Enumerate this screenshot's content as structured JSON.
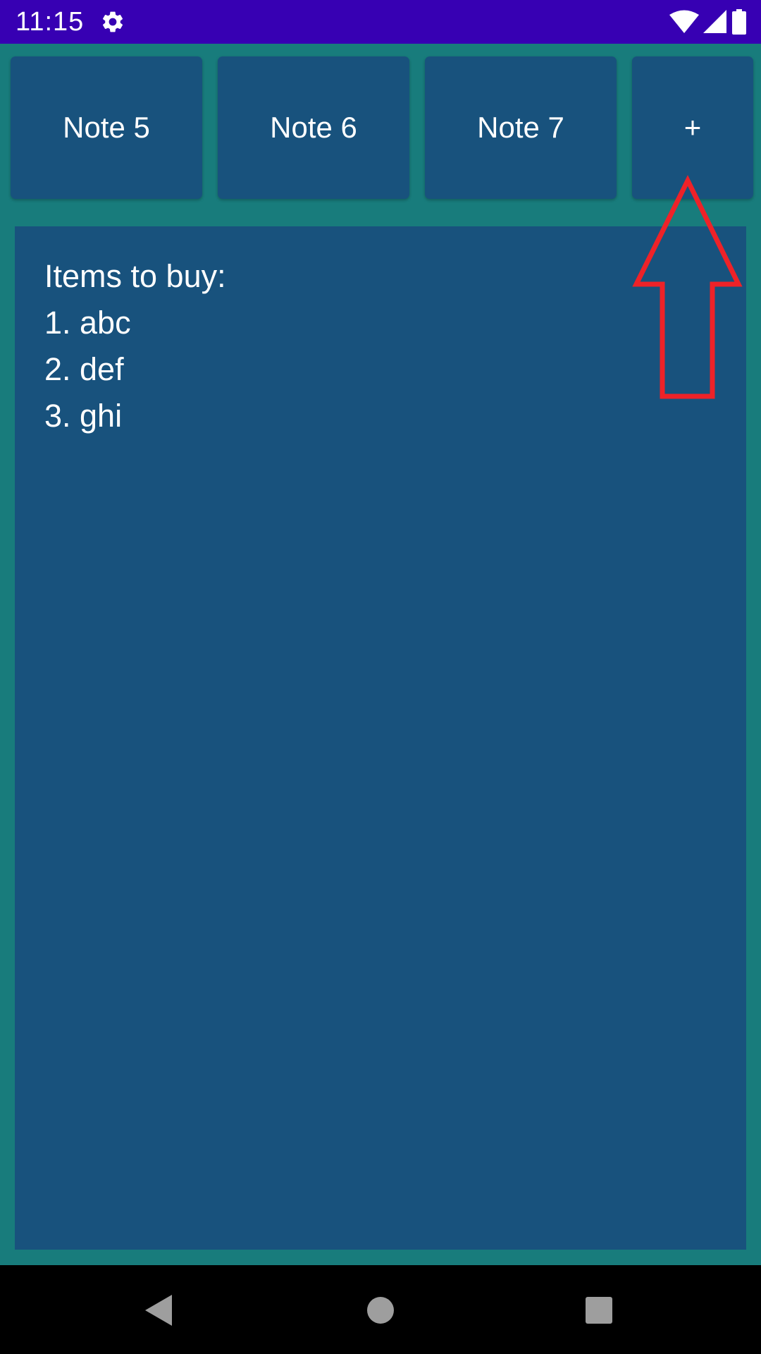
{
  "status_bar": {
    "time": "11:15",
    "icons": [
      "gear-icon",
      "wifi-icon",
      "signal-icon",
      "battery-icon"
    ],
    "color": "#3700b3"
  },
  "tabs": [
    {
      "label": "Note 5"
    },
    {
      "label": "Note 6"
    },
    {
      "label": "Note 7"
    }
  ],
  "add_tab": {
    "label": "+"
  },
  "note": {
    "lines": [
      "Items to buy:",
      "1. abc",
      "2. def",
      "3. ghi"
    ]
  },
  "colors": {
    "background": "#187c7c",
    "tab": "#18527d",
    "note": "#18527d",
    "annotation": "#ee2228"
  },
  "nav_bar": {
    "icons": [
      "back-icon",
      "home-icon",
      "recents-icon"
    ]
  }
}
